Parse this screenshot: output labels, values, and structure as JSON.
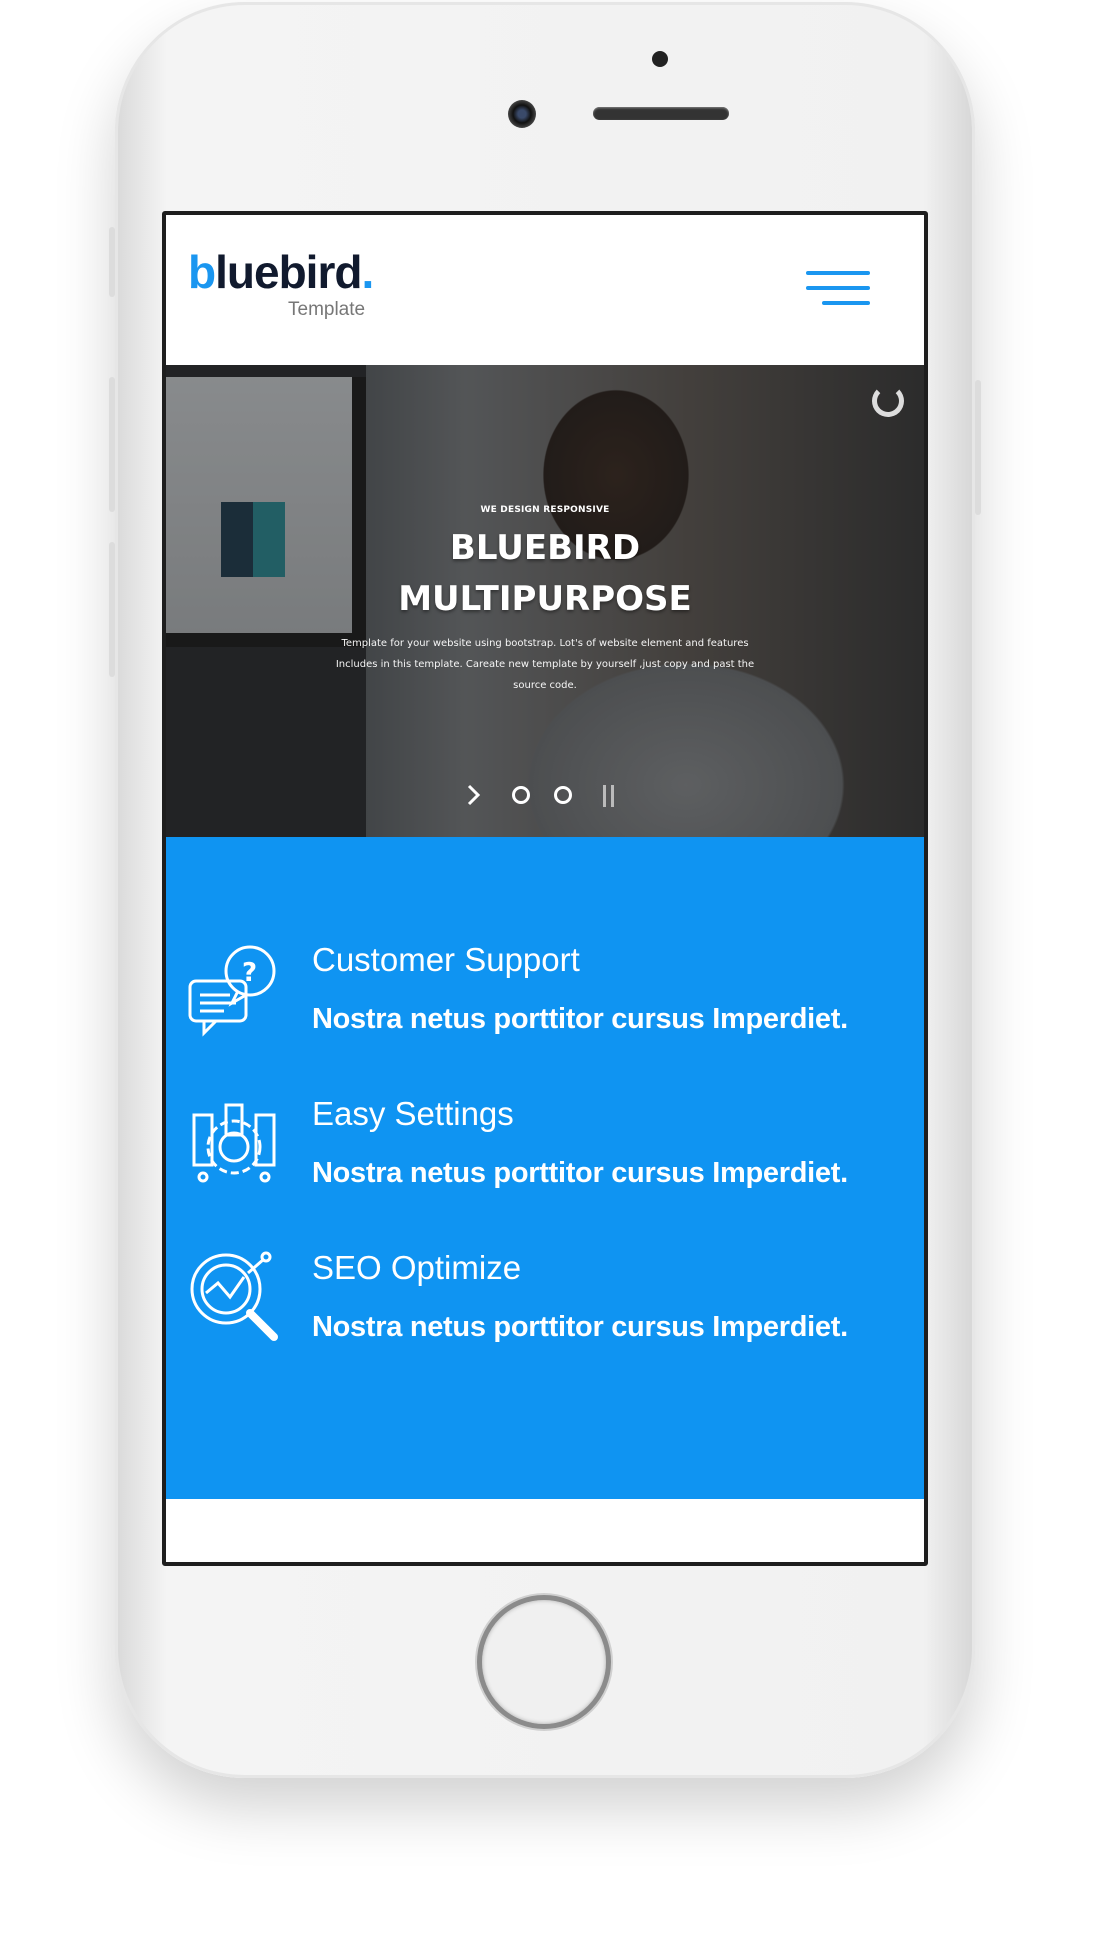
{
  "logo": {
    "word_accent": "b",
    "word_rest": "luebird",
    "dot": ".",
    "subtitle": "Template"
  },
  "header": {
    "menu_icon": "hamburger-icon"
  },
  "hero": {
    "kicker": "WE DESIGN RESPONSIVE",
    "title_line1": "BLUEBIRD",
    "title_line2": "MULTIPURPOSE",
    "description": "Template for your website using bootstrap. Lot's of website element and features Includes in this template. Careate new template by yourself ,just copy and past the source code.",
    "slides": 2,
    "controls": {
      "next": "chevron-right-icon",
      "pause": "pause-icon"
    }
  },
  "features": [
    {
      "icon": "customer-support-icon",
      "title": "Customer Support",
      "text": "Nostra netus porttitor cursus Imperdiet."
    },
    {
      "icon": "settings-icon",
      "title": "Easy Settings",
      "text": "Nostra netus porttitor cursus Imperdiet."
    },
    {
      "icon": "seo-icon",
      "title": "SEO Optimize",
      "text": "Nostra netus porttitor cursus Imperdiet."
    }
  ],
  "colors": {
    "brand": "#1a96f0",
    "feature_bg": "#0f94f2",
    "logo_dark": "#111a2e"
  }
}
